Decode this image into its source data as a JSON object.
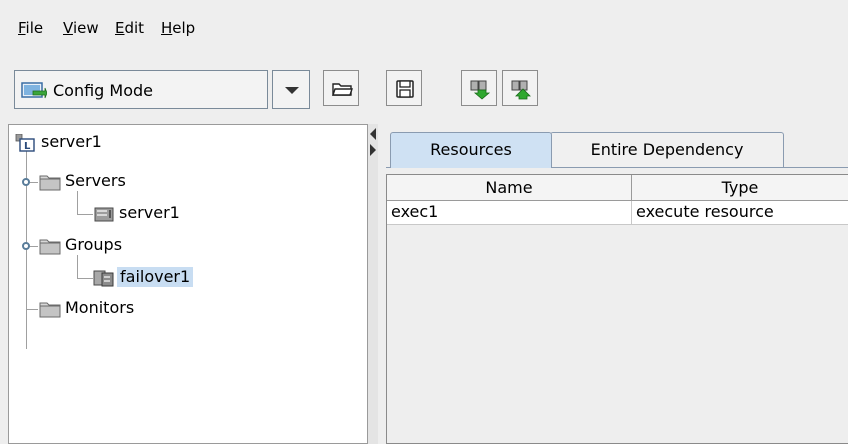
{
  "menu": {
    "file": "File",
    "view": "View",
    "edit": "Edit",
    "help": "Help"
  },
  "toolbar": {
    "mode_selected": "Config Mode",
    "buttons": [
      "open-folder-icon",
      "save-icon",
      "download-icon",
      "upload-icon"
    ]
  },
  "tree": {
    "root": "server1",
    "servers_folder": "Servers",
    "server_item": "server1",
    "groups_folder": "Groups",
    "group_item": "failover1",
    "monitors_folder": "Monitors"
  },
  "tabs": [
    "Resources",
    "Entire Dependency"
  ],
  "table": {
    "columns": [
      "Name",
      "Type"
    ],
    "rows": [
      [
        "exec1",
        "execute resource"
      ]
    ]
  },
  "colors": {
    "background": "#eeeeee",
    "selection": "#c8ddf2",
    "active_tab": "#cfe1f3"
  }
}
